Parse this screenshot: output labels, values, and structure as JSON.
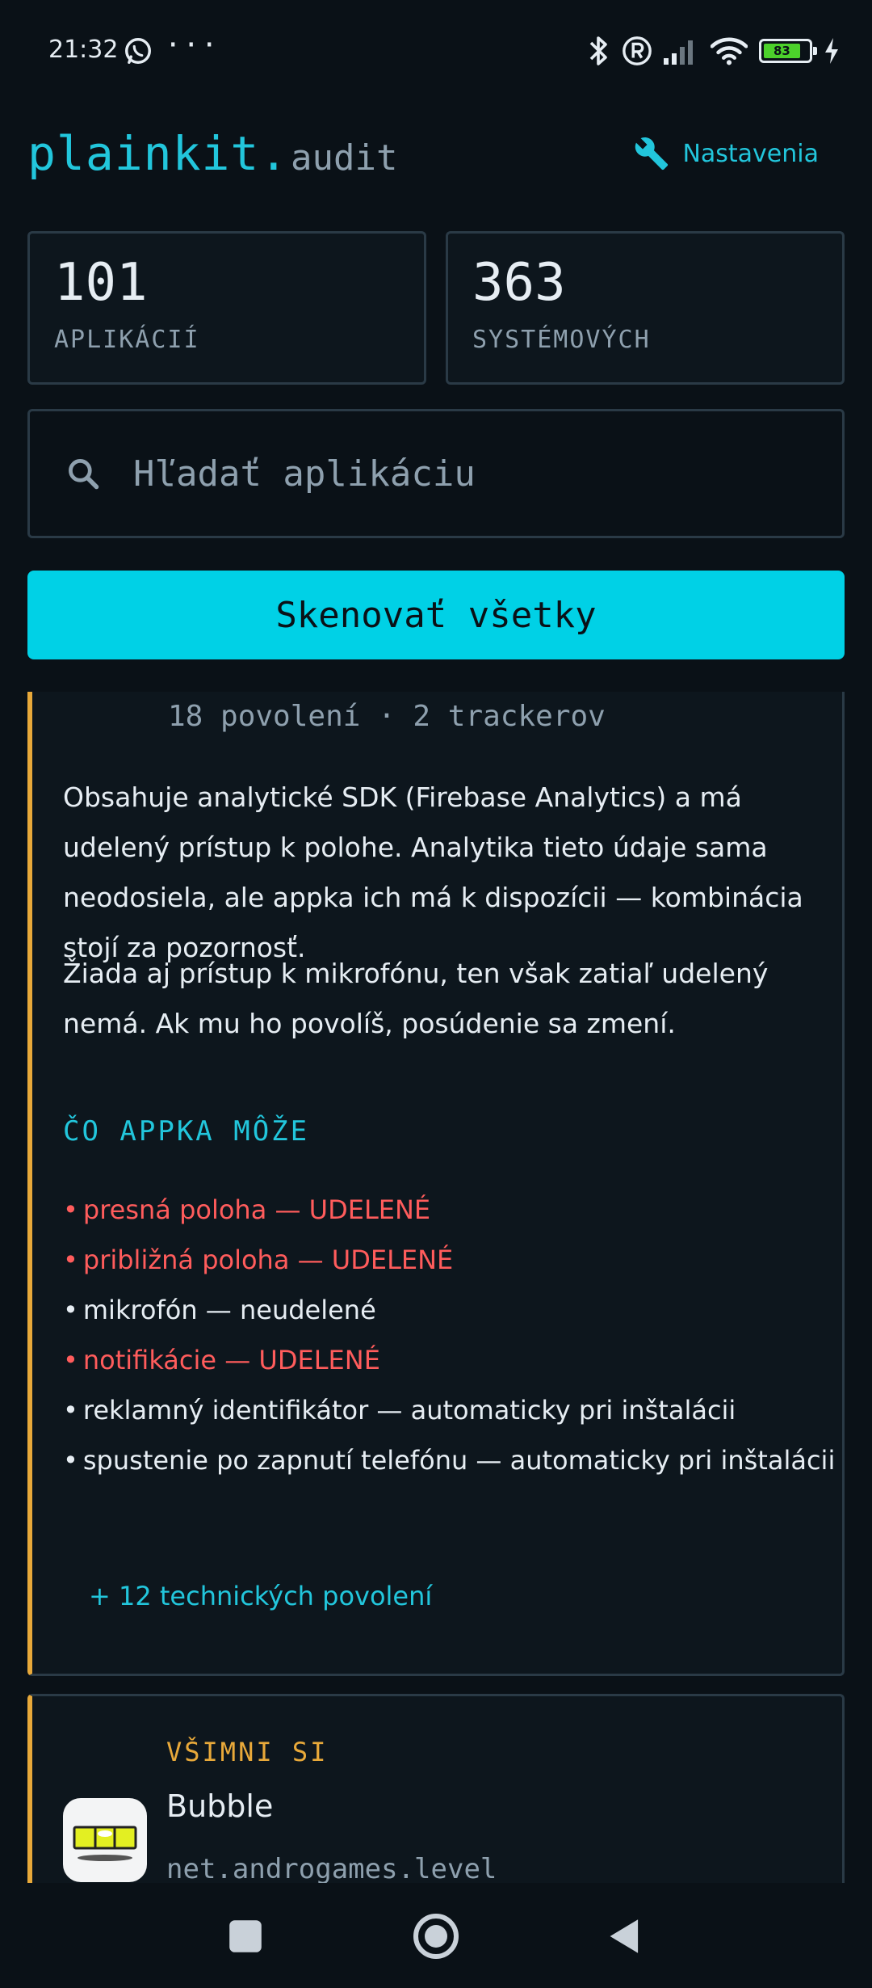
{
  "status_bar": {
    "time": "21:32",
    "battery_level": "83",
    "battery_percent": 83
  },
  "header": {
    "logo": "plainkit.",
    "subtitle": "audit",
    "settings_label": "Nastavenia"
  },
  "stats": [
    {
      "value": "101",
      "label": "APLIKÁCIÍ"
    },
    {
      "value": "363",
      "label": "SYSTÉMOVÝCH"
    }
  ],
  "search": {
    "placeholder": "Hľadať aplikáciu"
  },
  "scan_button": {
    "label": "Skenovať všetky"
  },
  "app_card": {
    "meta": "18 povolení · 2 trackerov",
    "description": [
      "Obsahuje analytické SDK (Firebase Analytics) a má udelený prístup k polohe. Analytika tieto údaje sama neodosiela, ale appka ich má k dispozícii — kombinácia stojí za pozornosť.",
      "Žiada aj prístup k mikrofónu, ten však zatiaľ udelený nemá. Ak mu ho povolíš, posúdenie sa zmení."
    ],
    "section_title": "ČO APPKA MÔŽE",
    "permissions": [
      {
        "text": "presná poloha — UDELENÉ",
        "granted": true
      },
      {
        "text": "približná poloha — UDELENÉ",
        "granted": true
      },
      {
        "text": "mikrofón — neudelené",
        "granted": false
      },
      {
        "text": "notifikácie — UDELENÉ",
        "granted": true
      },
      {
        "text": "reklamný identifikátor — automaticky pri inštalácii",
        "granted": false
      },
      {
        "text": "spustenie po zapnutí telefónu — automaticky pri inštalácii",
        "granted": false
      }
    ],
    "more_link": "+ 12 technických povolení"
  },
  "notice_card": {
    "badge": "VŠIMNI SI",
    "app_name": "Bubble",
    "package": "net.androgames.level"
  },
  "colors": {
    "accent": "#22c6dc",
    "button": "#00d1e6",
    "warning": "#e8a93a",
    "granted": "#ff5c5c",
    "background": "#0a1117"
  },
  "icons": [
    "whatsapp-icon",
    "bluetooth-icon",
    "registered-icon",
    "signal-icon",
    "wifi-icon",
    "battery-icon",
    "charging-icon",
    "wrench-icon",
    "search-icon",
    "spirit-level-icon",
    "recents-icon",
    "home-icon",
    "back-icon"
  ]
}
